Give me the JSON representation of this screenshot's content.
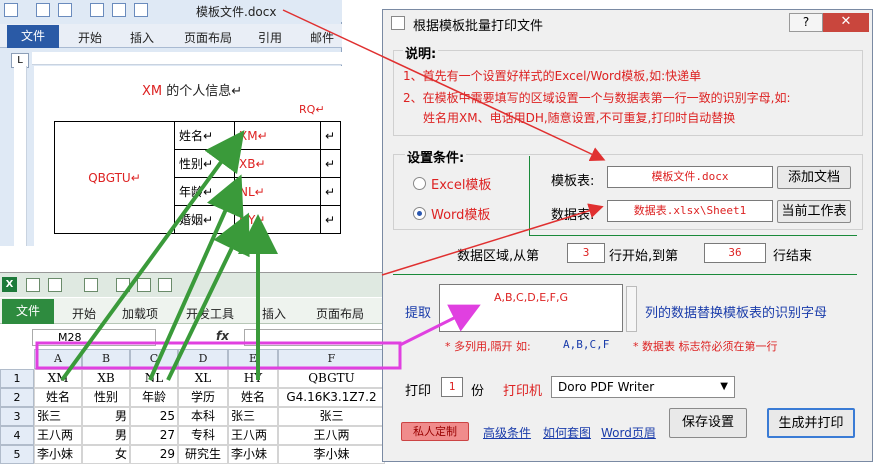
{
  "word": {
    "title": "模板文件.docx",
    "tabs": [
      "文件",
      "开始",
      "插入",
      "页面布局",
      "引用",
      "邮件"
    ],
    "ruler_corner": "L",
    "doc": {
      "title_prefix": "XM",
      "title_suffix": "的个人信息",
      "rq": "RQ",
      "photo_code": "QBGTU",
      "rows": [
        {
          "label": "姓名",
          "code": "XM"
        },
        {
          "label": "性别",
          "code": "XB"
        },
        {
          "label": "年龄",
          "code": "NL"
        },
        {
          "label": "婚姻",
          "code": "HY"
        }
      ]
    }
  },
  "excel": {
    "tabs": [
      "文件",
      "开始",
      "加载项",
      "开发工具",
      "插入",
      "页面布局"
    ],
    "name_box": "M28",
    "fx": "fx",
    "columns": [
      "A",
      "B",
      "C",
      "D",
      "E",
      "F"
    ],
    "rows": [
      {
        "num": "1",
        "cells": [
          "XM",
          "XB",
          "NL",
          "XL",
          "HY",
          "QBGTU"
        ]
      },
      {
        "num": "2",
        "cells": [
          "姓名",
          "性别",
          "年龄",
          "学历",
          "姓名",
          "G4.16K3.1Z7.2"
        ]
      },
      {
        "num": "3",
        "cells": [
          "张三",
          "男",
          "25",
          "本科",
          "张三",
          "张三"
        ]
      },
      {
        "num": "4",
        "cells": [
          "王八两",
          "男",
          "27",
          "专科",
          "王八两",
          "王八两"
        ]
      },
      {
        "num": "5",
        "cells": [
          "李小妹",
          "女",
          "29",
          "研究生",
          "李小妹",
          "李小妹"
        ]
      }
    ]
  },
  "dialog": {
    "title": "根据模板批量打印文件",
    "help_btn": "?",
    "close_btn": "✕",
    "instructions": {
      "legend": "说明:",
      "line1": "1、首先有一个设置好样式的Excel/Word模板,如:快递单",
      "line2": "2、在模板中需要填写的区域设置一个与数据表第一行一致的识别字母,如:",
      "line3": "姓名用XM、电话用DH,随意设置,不可重复,打印时自动替换"
    },
    "settings": {
      "legend": "设置条件:",
      "excel_option": "Excel模板",
      "word_option": "Word模板",
      "template_label": "模板表:",
      "template_value": "模板文件.docx",
      "add_doc_btn": "添加文档",
      "data_label": "数据表:",
      "data_value": "数据表.xlsx\\Sheet1",
      "current_sheet_btn": "当前工作表"
    },
    "range": {
      "prefix": "数据区域,从第",
      "start": "3",
      "mid": "行开始,到第",
      "end": "36",
      "suffix": "行结束"
    },
    "extract": {
      "label": "提取",
      "value": "A,B,C,D,E,F,G",
      "desc": "列的数据替换模板表的识别字母",
      "note1": "* 多列用,隔开 如:",
      "note1_example": "A,B,C,F",
      "note2": "* 数据表 标志符必须在第一行"
    },
    "print": {
      "label": "打印",
      "copies": "1",
      "copies_unit": "份",
      "printer_label": "打印机",
      "printer": "Doro PDF Writer"
    },
    "footer": {
      "custom_btn": "私人定制",
      "advanced_link": "高级条件",
      "howto_link": "如何套图",
      "word_page_link": "Word页眉",
      "save_btn": "保存设置",
      "generate_btn": "生成并打印"
    }
  },
  "colors": {
    "red": "#dd2222",
    "arrow_green": "#3a9a3a",
    "arrow_red": "#e03030",
    "highlight_magenta": "#e040e0",
    "word_blue": "#2a5aa6",
    "excel_green": "#2e8b3f"
  }
}
